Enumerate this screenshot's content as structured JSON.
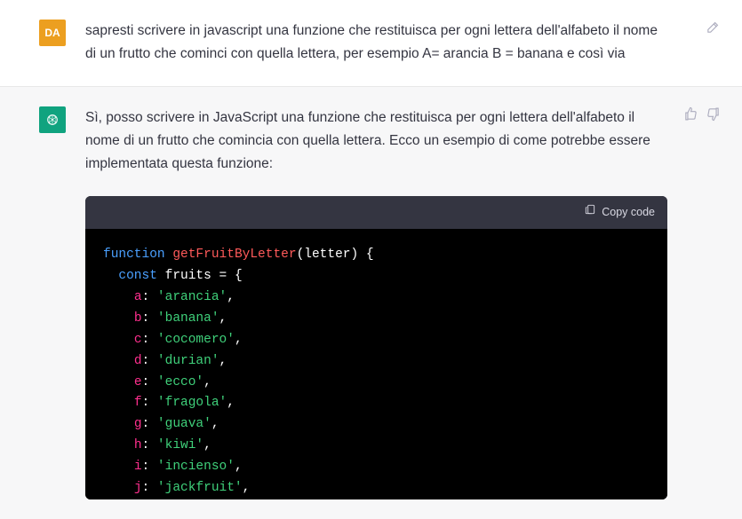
{
  "user": {
    "avatar_initials": "DA",
    "text": "sapresti scrivere in javascript una funzione che restituisca per ogni lettera dell'alfabeto il nome di un frutto che cominci con quella lettera, per esempio A= arancia B = banana e così via"
  },
  "assistant": {
    "intro_text": "Sì, posso scrivere in JavaScript una funzione che restituisca per ogni lettera dell'alfabeto il nome di un frutto che comincia con quella lettera. Ecco un esempio di come potrebbe essere implementata questa funzione:",
    "copy_label": "Copy code",
    "code": {
      "kw_function": "function",
      "func_name": "getFruitByLetter",
      "open_paren": "(",
      "param": "letter",
      "close_paren_brace": ") {",
      "kw_const": "const",
      "var_name": "fruits",
      "eq_brace": " = {",
      "entries": [
        {
          "key": "a",
          "val": "'arancia'"
        },
        {
          "key": "b",
          "val": "'banana'"
        },
        {
          "key": "c",
          "val": "'cocomero'"
        },
        {
          "key": "d",
          "val": "'durian'"
        },
        {
          "key": "e",
          "val": "'ecco'"
        },
        {
          "key": "f",
          "val": "'fragola'"
        },
        {
          "key": "g",
          "val": "'guava'"
        },
        {
          "key": "h",
          "val": "'kiwi'"
        },
        {
          "key": "i",
          "val": "'incienso'"
        },
        {
          "key": "j",
          "val": "'jackfruit'"
        }
      ],
      "colon": ":",
      "comma": ","
    }
  }
}
